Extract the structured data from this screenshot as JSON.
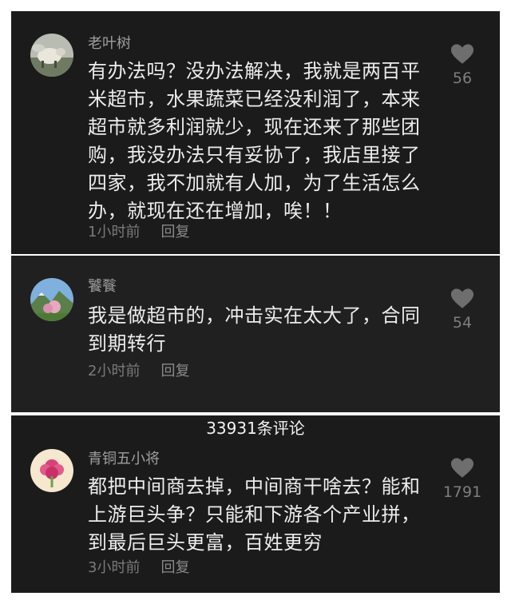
{
  "comments_header": "33931条评论",
  "comments": [
    {
      "username": "老叶树",
      "text": "有办法吗？没办法解决，我就是两百平米超市，水果蔬菜已经没利润了，本来超市就多利润就少，现在还来了那些团购，我没办法只有妥协了，我店里接了四家，我不加就有人加，为了生活怎么办，就现在还在增加，唉！！",
      "time": "1小时前",
      "reply_label": "回复",
      "likes": "56",
      "avatar_icon": "sheep-avatar-icon"
    },
    {
      "username": "饕餮",
      "text": "我是做超市的，冲击实在太大了，合同到期转行",
      "time": "2小时前",
      "reply_label": "回复",
      "likes": "54",
      "avatar_icon": "landscape-avatar-icon"
    },
    {
      "username": "青铜五小将",
      "text": "都把中间商去掉，中间商干啥去？能和上游巨头争？只能和下游各个产业拼，到最后巨头更富，百姓更穷",
      "time": "3小时前",
      "reply_label": "回复",
      "likes": "1791",
      "avatar_icon": "flower-avatar-icon"
    }
  ],
  "colors": {
    "panel_bg": "#1b1b1b",
    "text_primary": "#ececec",
    "text_secondary": "#9e9e9e",
    "heart": "#6e6e6e"
  }
}
